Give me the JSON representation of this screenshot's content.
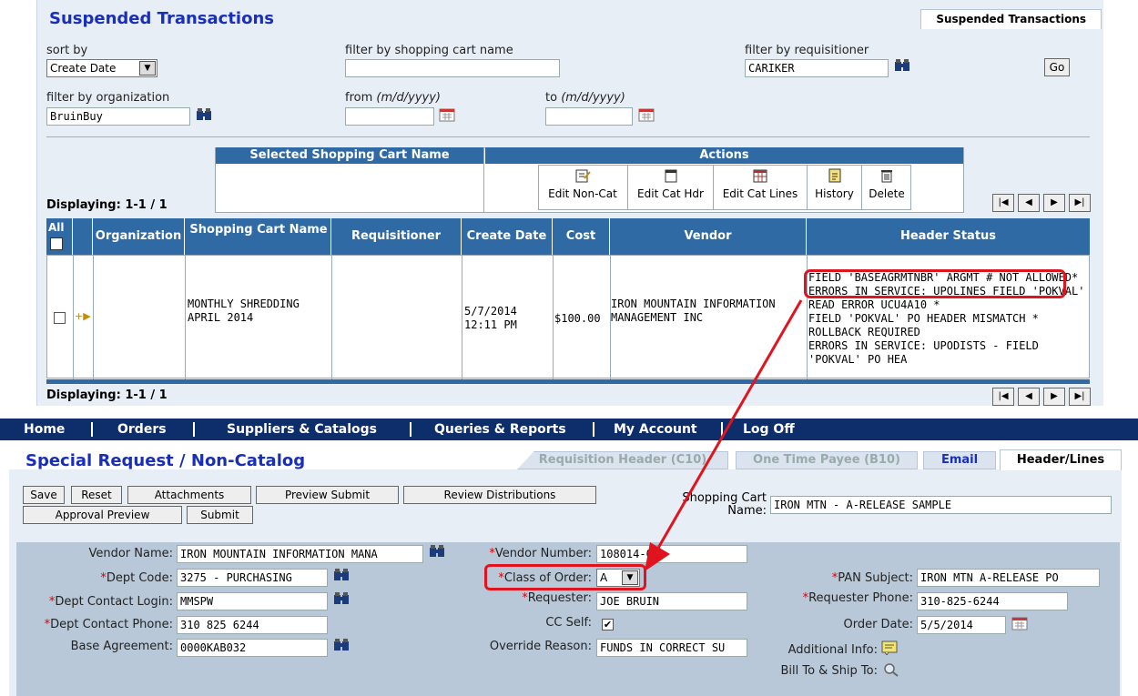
{
  "suspended": {
    "title": "Suspended Transactions",
    "tab": "Suspended Transactions",
    "sort_by_label": "sort by",
    "sort_by_value": "Create Date",
    "filter_cart_label": "filter by shopping cart name",
    "filter_cart_value": "",
    "filter_req_label": "filter by requisitioner",
    "filter_req_value": "CARIKER",
    "go": "Go",
    "filter_org_label": "filter by organization",
    "filter_org_value": "BruinBuy",
    "from_label": "from",
    "from_format": "(m/d/yyyy)",
    "to_label": "to",
    "to_format": "(m/d/yyyy)",
    "selected_cart_header": "Selected Shopping Cart Name",
    "actions_header": "Actions",
    "actions": [
      "Edit Non-Cat",
      "Edit Cat Hdr",
      "Edit Cat Lines",
      "History",
      "Delete"
    ],
    "displaying_top": "Displaying: 1-1 / 1",
    "displaying_bottom": "Displaying: 1-1 / 1",
    "columns": {
      "all": "All",
      "org": "Organization",
      "cart": "Shopping Cart Name",
      "requisitioner": "Requisitioner",
      "create": "Create Date",
      "cost": "Cost",
      "vendor": "Vendor",
      "status": "Header Status"
    },
    "row": {
      "org": "",
      "cart": "MONTHLY SHREDDING APRIL 2014",
      "requisitioner": "",
      "create_date": "5/7/2014",
      "create_time": "12:11 PM",
      "cost": "$100.00",
      "vendor": "IRON MOUNTAIN INFORMATION MANAGEMENT INC",
      "status_lines": [
        "FIELD 'BASEAGRMTNBR' ARGMT # NOT ALLOWED*",
        "ERRORS IN SERVICE: UPOLINES   FIELD 'POKVAL' READ ERROR UCU4A10 *",
        "FIELD 'POKVAL' PO HEADER MISMATCH *",
        "ROLLBACK REQUIRED",
        "ERRORS IN SERVICE: UPODISTS - FIELD 'POKVAL' PO HEA"
      ]
    }
  },
  "nav": [
    "Home",
    "Orders",
    "Suppliers & Catalogs",
    "Queries & Reports",
    "My Account",
    "Log Off"
  ],
  "special": {
    "title": "Special Request / Non-Catalog",
    "tabs": [
      "Requisition Header (C10)",
      "One Time Payee (B10)",
      "Email",
      "Header/Lines"
    ],
    "buttons": [
      "Save",
      "Reset",
      "Attachments",
      "Preview Submit",
      "Review Distributions",
      "Approval Preview",
      "Submit"
    ],
    "cart_name_label": "Shopping Cart Name:",
    "cart_name_value": "IRON MTN - A-RELEASE SAMPLE",
    "fields": {
      "vendor_name_label": "Vendor Name:",
      "vendor_name": "IRON MOUNTAIN INFORMATION MANA",
      "dept_code_label": "Dept Code:",
      "dept_code": "3275 - PURCHASING",
      "dept_login_label": "Dept Contact Login:",
      "dept_login": "MMSPW",
      "dept_phone_label": "Dept Contact Phone:",
      "dept_phone": "310 825 6244",
      "base_agreement_label": "Base Agreement:",
      "base_agreement": "0000KAB032",
      "vendor_number_label": "Vendor Number:",
      "vendor_number": "108014-01",
      "class_order_label": "Class of Order:",
      "class_order": "A",
      "requester_label": "Requester:",
      "requester": "JOE BRUIN",
      "cc_self_label": "CC Self:",
      "override_label": "Override Reason:",
      "override": "FUNDS IN CORRECT SU",
      "pan_subject_label": "PAN Subject:",
      "pan_subject": "IRON MTN A-RELEASE PO",
      "req_phone_label": "Requester Phone:",
      "req_phone": "310-825-6244",
      "order_date_label": "Order Date:",
      "order_date": "5/5/2014",
      "additional_info_label": "Additional Info:",
      "bill_to_label": "Bill To & Ship To:"
    }
  },
  "colors": {
    "title": "#1a2fb8",
    "header_blue": "#2f6aa4",
    "nav": "#0d2d6b",
    "highlight": "#e0141e"
  }
}
